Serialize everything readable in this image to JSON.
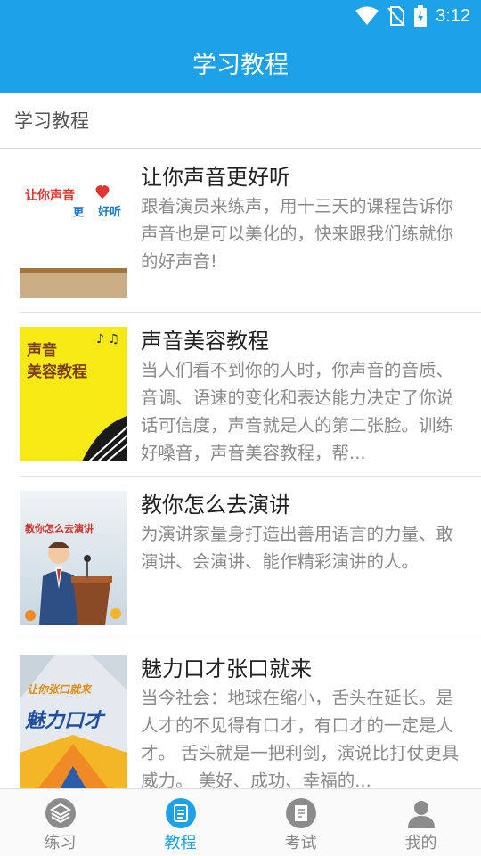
{
  "status_bar": {
    "time": "3:12",
    "icons": [
      "wifi-icon",
      "no-sim-icon",
      "battery-charging-icon"
    ]
  },
  "app_bar": {
    "title": "学习教程"
  },
  "section": {
    "title": "学习教程"
  },
  "items": [
    {
      "title": "让你声音更好听",
      "description": "跟着演员来练声，用十三天的课程告诉你声音也是可以美化的，快来跟我们练就你的好声音!",
      "thumb_text_1": "让你声音",
      "thumb_text_2": "更",
      "thumb_text_3": "好听"
    },
    {
      "title": "声音美容教程",
      "description": "当人们看不到你的人时，你声音的音质、音调、语速的变化和表达能力决定了你说话可信度，声音就是人的第二张脸。训练好嗓音，声音美容教程，帮...",
      "thumb_text_1": "声音",
      "thumb_text_2": "美容教程"
    },
    {
      "title": "教你怎么去演讲",
      "description": "为演讲家量身打造出善用语言的力量、敢演讲、会演讲、能作精彩演讲的人。",
      "thumb_text_1": "教你怎么去演讲"
    },
    {
      "title": "魅力口才张口就来",
      "description": "当今社会：地球在缩小，舌头在延长。是人才的不见得有口才，有口才的一定是人才。 舌头就是一把利剑，演说比打仗更具威力。 美好、成功、幸福的...",
      "thumb_text_1": "让你张口就来",
      "thumb_text_2": "魅力口才"
    }
  ],
  "bottom_nav": {
    "active": "教程",
    "accent_color": "#1da1e8",
    "tabs": [
      {
        "label": "练习",
        "icon": "layers-icon"
      },
      {
        "label": "教程",
        "icon": "document-icon"
      },
      {
        "label": "考试",
        "icon": "exam-paper-icon"
      },
      {
        "label": "我的",
        "icon": "person-icon"
      }
    ]
  }
}
